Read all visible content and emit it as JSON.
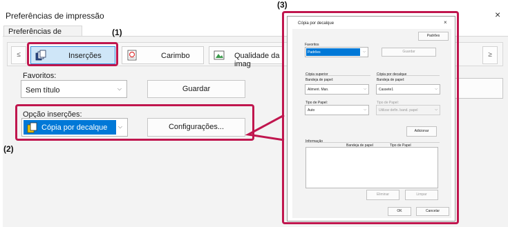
{
  "window": {
    "title": "Preferências de impressão",
    "close": "×",
    "tab": "Preferências de impressão"
  },
  "nav": {
    "prev": "≤",
    "next": "≥"
  },
  "functions": [
    {
      "label": "Inserções",
      "icon": "insert-pages-icon",
      "selected": true
    },
    {
      "label": "Carimbo",
      "icon": "stamp-icon",
      "selected": false
    },
    {
      "label": "Qualidade da imag",
      "icon": "image-quality-icon",
      "selected": false
    }
  ],
  "favorites": {
    "label": "Favoritos:",
    "value": "Sem título",
    "save": "Guardar"
  },
  "insert_option": {
    "label": "Opção inserções:",
    "value": "Cópia por decalque",
    "settings": "Configurações..."
  },
  "callouts": {
    "c1": "(1)",
    "c2": "(2)",
    "c3": "(3)"
  },
  "dialog": {
    "title": "Cópia por decalque",
    "close": "×",
    "defaults_button": "Padrões",
    "favorites_label": "Favoritos",
    "favorites_value": "Padrões",
    "save_button": "Guardar",
    "top_copy": {
      "title": "Cópia superior",
      "tray_label": "Bandeja de papel:",
      "tray_value": "Aliment. Man.",
      "type_label": "Tipo de Papel:",
      "type_value": "Auto"
    },
    "carbon_copy": {
      "title": "Cópia por decalque",
      "tray_label": "Bandeja de papel:",
      "tray_value": "Cassete1",
      "type_label": "Tipo de Papel:",
      "type_value": "Utilizar defin. band. papel"
    },
    "add_button": "Adicionar",
    "info": {
      "title": "Informação",
      "col_tray": "Bandeja de papel",
      "col_type": "Tipo de Papel"
    },
    "delete_button": "Eliminar",
    "clear_button": "Limpar",
    "ok_button": "OK",
    "cancel_button": "Cancelar"
  },
  "colors": {
    "highlight": "#c0164e",
    "selection": "#0078d7",
    "selected_tile": "#cfe6f8"
  }
}
